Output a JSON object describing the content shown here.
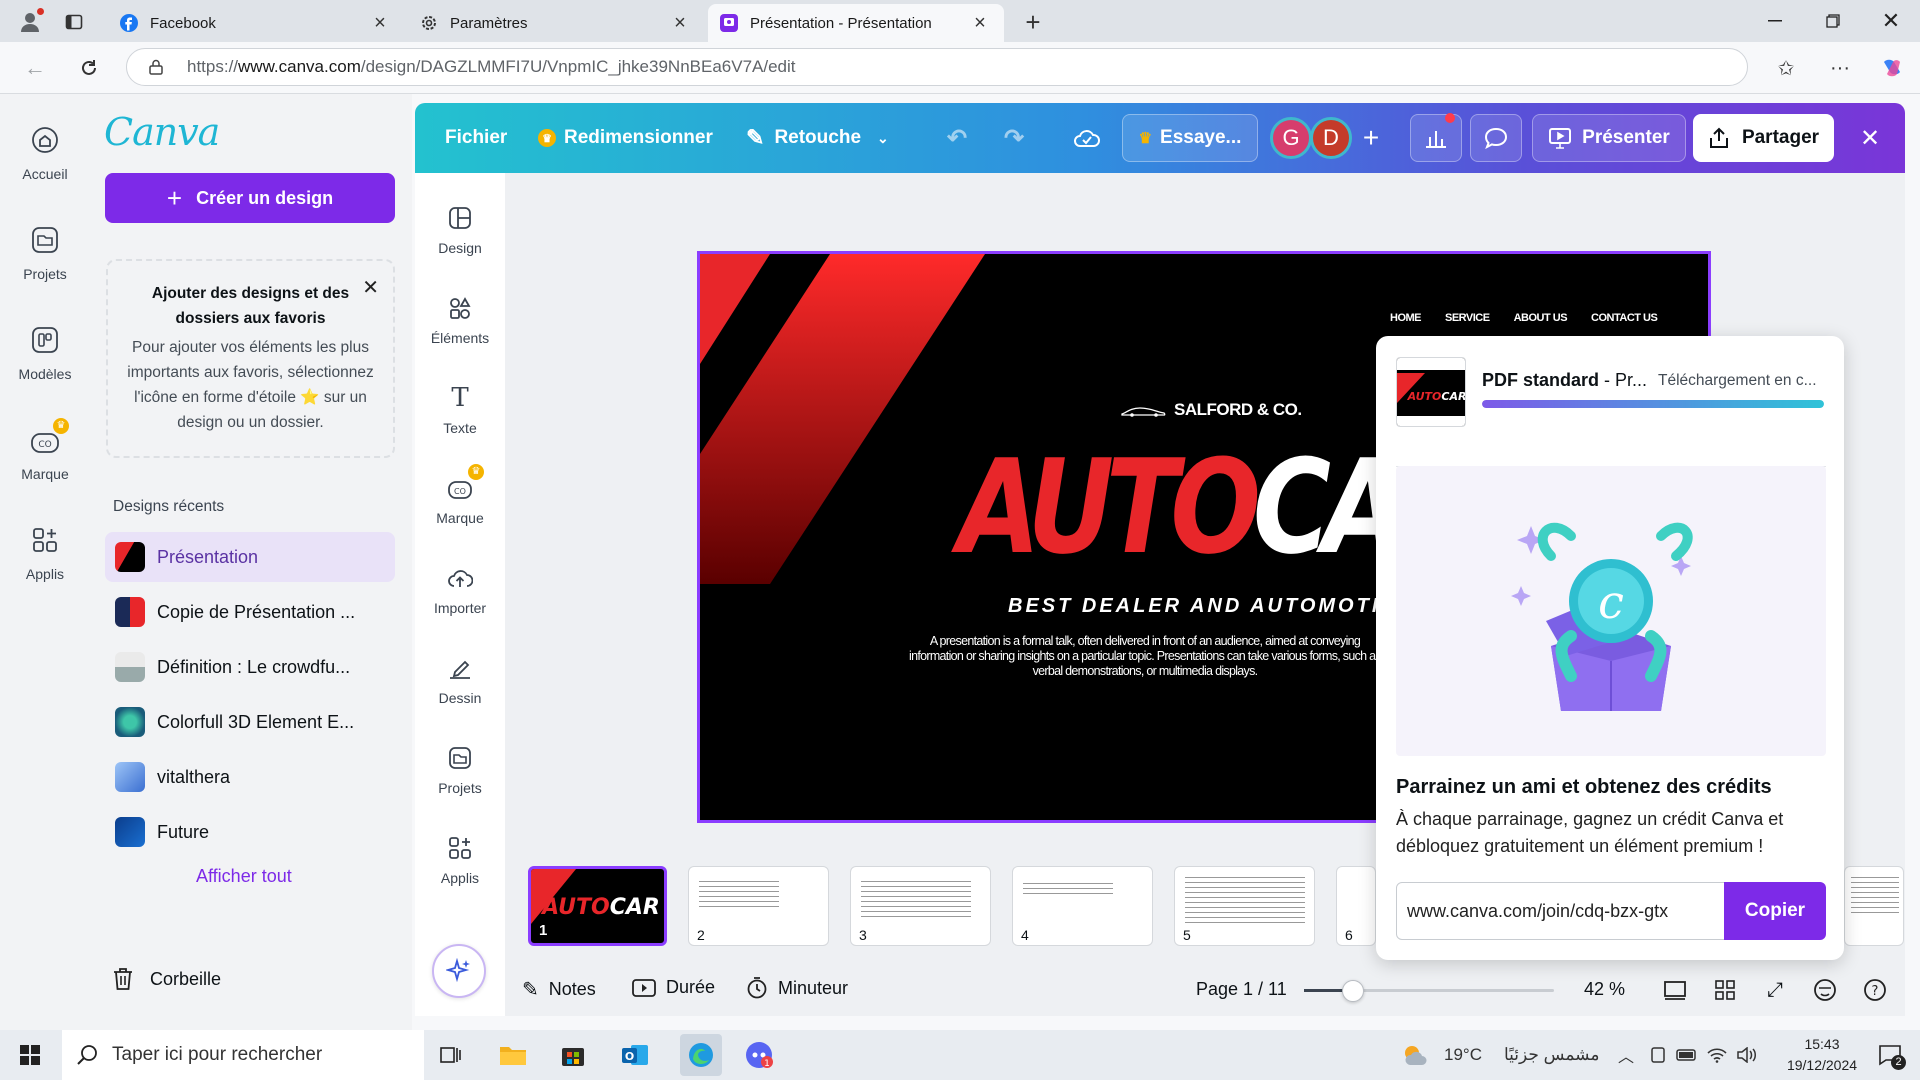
{
  "browser": {
    "tabs": [
      {
        "title": "Facebook",
        "icon": "facebook-icon"
      },
      {
        "title": "Paramètres",
        "icon": "gear-icon"
      },
      {
        "title": "Présentation - Présentation",
        "icon": "canva-icon"
      }
    ],
    "url_prefix": "https://",
    "url_host": "www.canva.com",
    "url_path": "/design/DAGZLMMFI7U/VnpmIC_jhke39NnBEa6V7A/edit"
  },
  "leftnav": [
    {
      "label": "Accueil",
      "icon": "home-icon"
    },
    {
      "label": "Projets",
      "icon": "folder-icon"
    },
    {
      "label": "Modèles",
      "icon": "templates-icon"
    },
    {
      "label": "Marque",
      "icon": "brand-icon"
    },
    {
      "label": "Applis",
      "icon": "apps-icon"
    }
  ],
  "panel": {
    "logo": "Canva",
    "create_label": "Créer un design",
    "fav_title": "Ajouter des designs et des dossiers aux favoris",
    "fav_text": "Pour ajouter vos éléments les plus importants aux favoris, sélectionnez l'icône en forme d'étoile ⭐ sur un design ou un dossier.",
    "recent_title": "Designs récents",
    "recent": [
      {
        "label": "Présentation"
      },
      {
        "label": "Copie de Présentation ..."
      },
      {
        "label": "Définition : Le crowdfu..."
      },
      {
        "label": "Colorfull 3D Element E..."
      },
      {
        "label": "vitalthera"
      },
      {
        "label": "Future"
      }
    ],
    "see_all": "Afficher tout",
    "trash": "Corbeille"
  },
  "topbar": {
    "file": "Fichier",
    "resize": "Redimensionner",
    "edit": "Retouche",
    "try": "Essaye...",
    "avatars": [
      "G",
      "D"
    ],
    "present": "Présenter",
    "share": "Partager"
  },
  "tools": [
    {
      "label": "Design",
      "icon": "design-icon"
    },
    {
      "label": "Éléments",
      "icon": "elements-icon"
    },
    {
      "label": "Texte",
      "icon": "text-icon"
    },
    {
      "label": "Marque",
      "icon": "brand-icon"
    },
    {
      "label": "Importer",
      "icon": "upload-icon"
    },
    {
      "label": "Dessin",
      "icon": "draw-icon"
    },
    {
      "label": "Projets",
      "icon": "folder-icon"
    },
    {
      "label": "Applis",
      "icon": "apps-icon"
    }
  ],
  "slide": {
    "nav": [
      "HOME",
      "SERVICE",
      "ABOUT US",
      "CONTACT US"
    ],
    "brand": "SALFORD & CO.",
    "title_red": "AUTO",
    "title_white": "CAR",
    "subtitle": "BEST DEALER AND AUTOMOTIVE",
    "body": "A presentation is a formal talk, often delivered in front of an audience, aimed at conveying information or sharing insights on a particular topic. Presentations can take various forms, such as verbal demonstrations, or multimedia displays."
  },
  "thumbnails": [
    "1",
    "2",
    "3",
    "4",
    "5",
    "6"
  ],
  "bottombar": {
    "notes": "Notes",
    "duration": "Durée",
    "timer": "Minuteur",
    "page": "Page 1 / 11",
    "zoom": "42 %",
    "zoom_value": 42
  },
  "popup": {
    "file_label": "PDF standard",
    "file_sep": " - Pr...",
    "status": "Téléchargement en c...",
    "progress_percent": 100,
    "promo_title": "Parrainez un ami et obtenez des crédits",
    "promo_text": "À chaque parrainage, gagnez un crédit Canva et débloquez gratuitement un élément premium !",
    "invite_link": "www.canva.com/join/cdq-bzx-gtx",
    "copy_label": "Copier"
  },
  "taskbar": {
    "search": "Taper ici pour rechercher",
    "weather": "19°C",
    "weather_text": "مشمس جزئيًا",
    "time": "15:43",
    "date": "19/12/2024",
    "notif_count": "2"
  },
  "colors": {
    "accent": "#7d2ae8",
    "canva_teal": "#1fb6d4",
    "slide_red": "#e8262a"
  }
}
